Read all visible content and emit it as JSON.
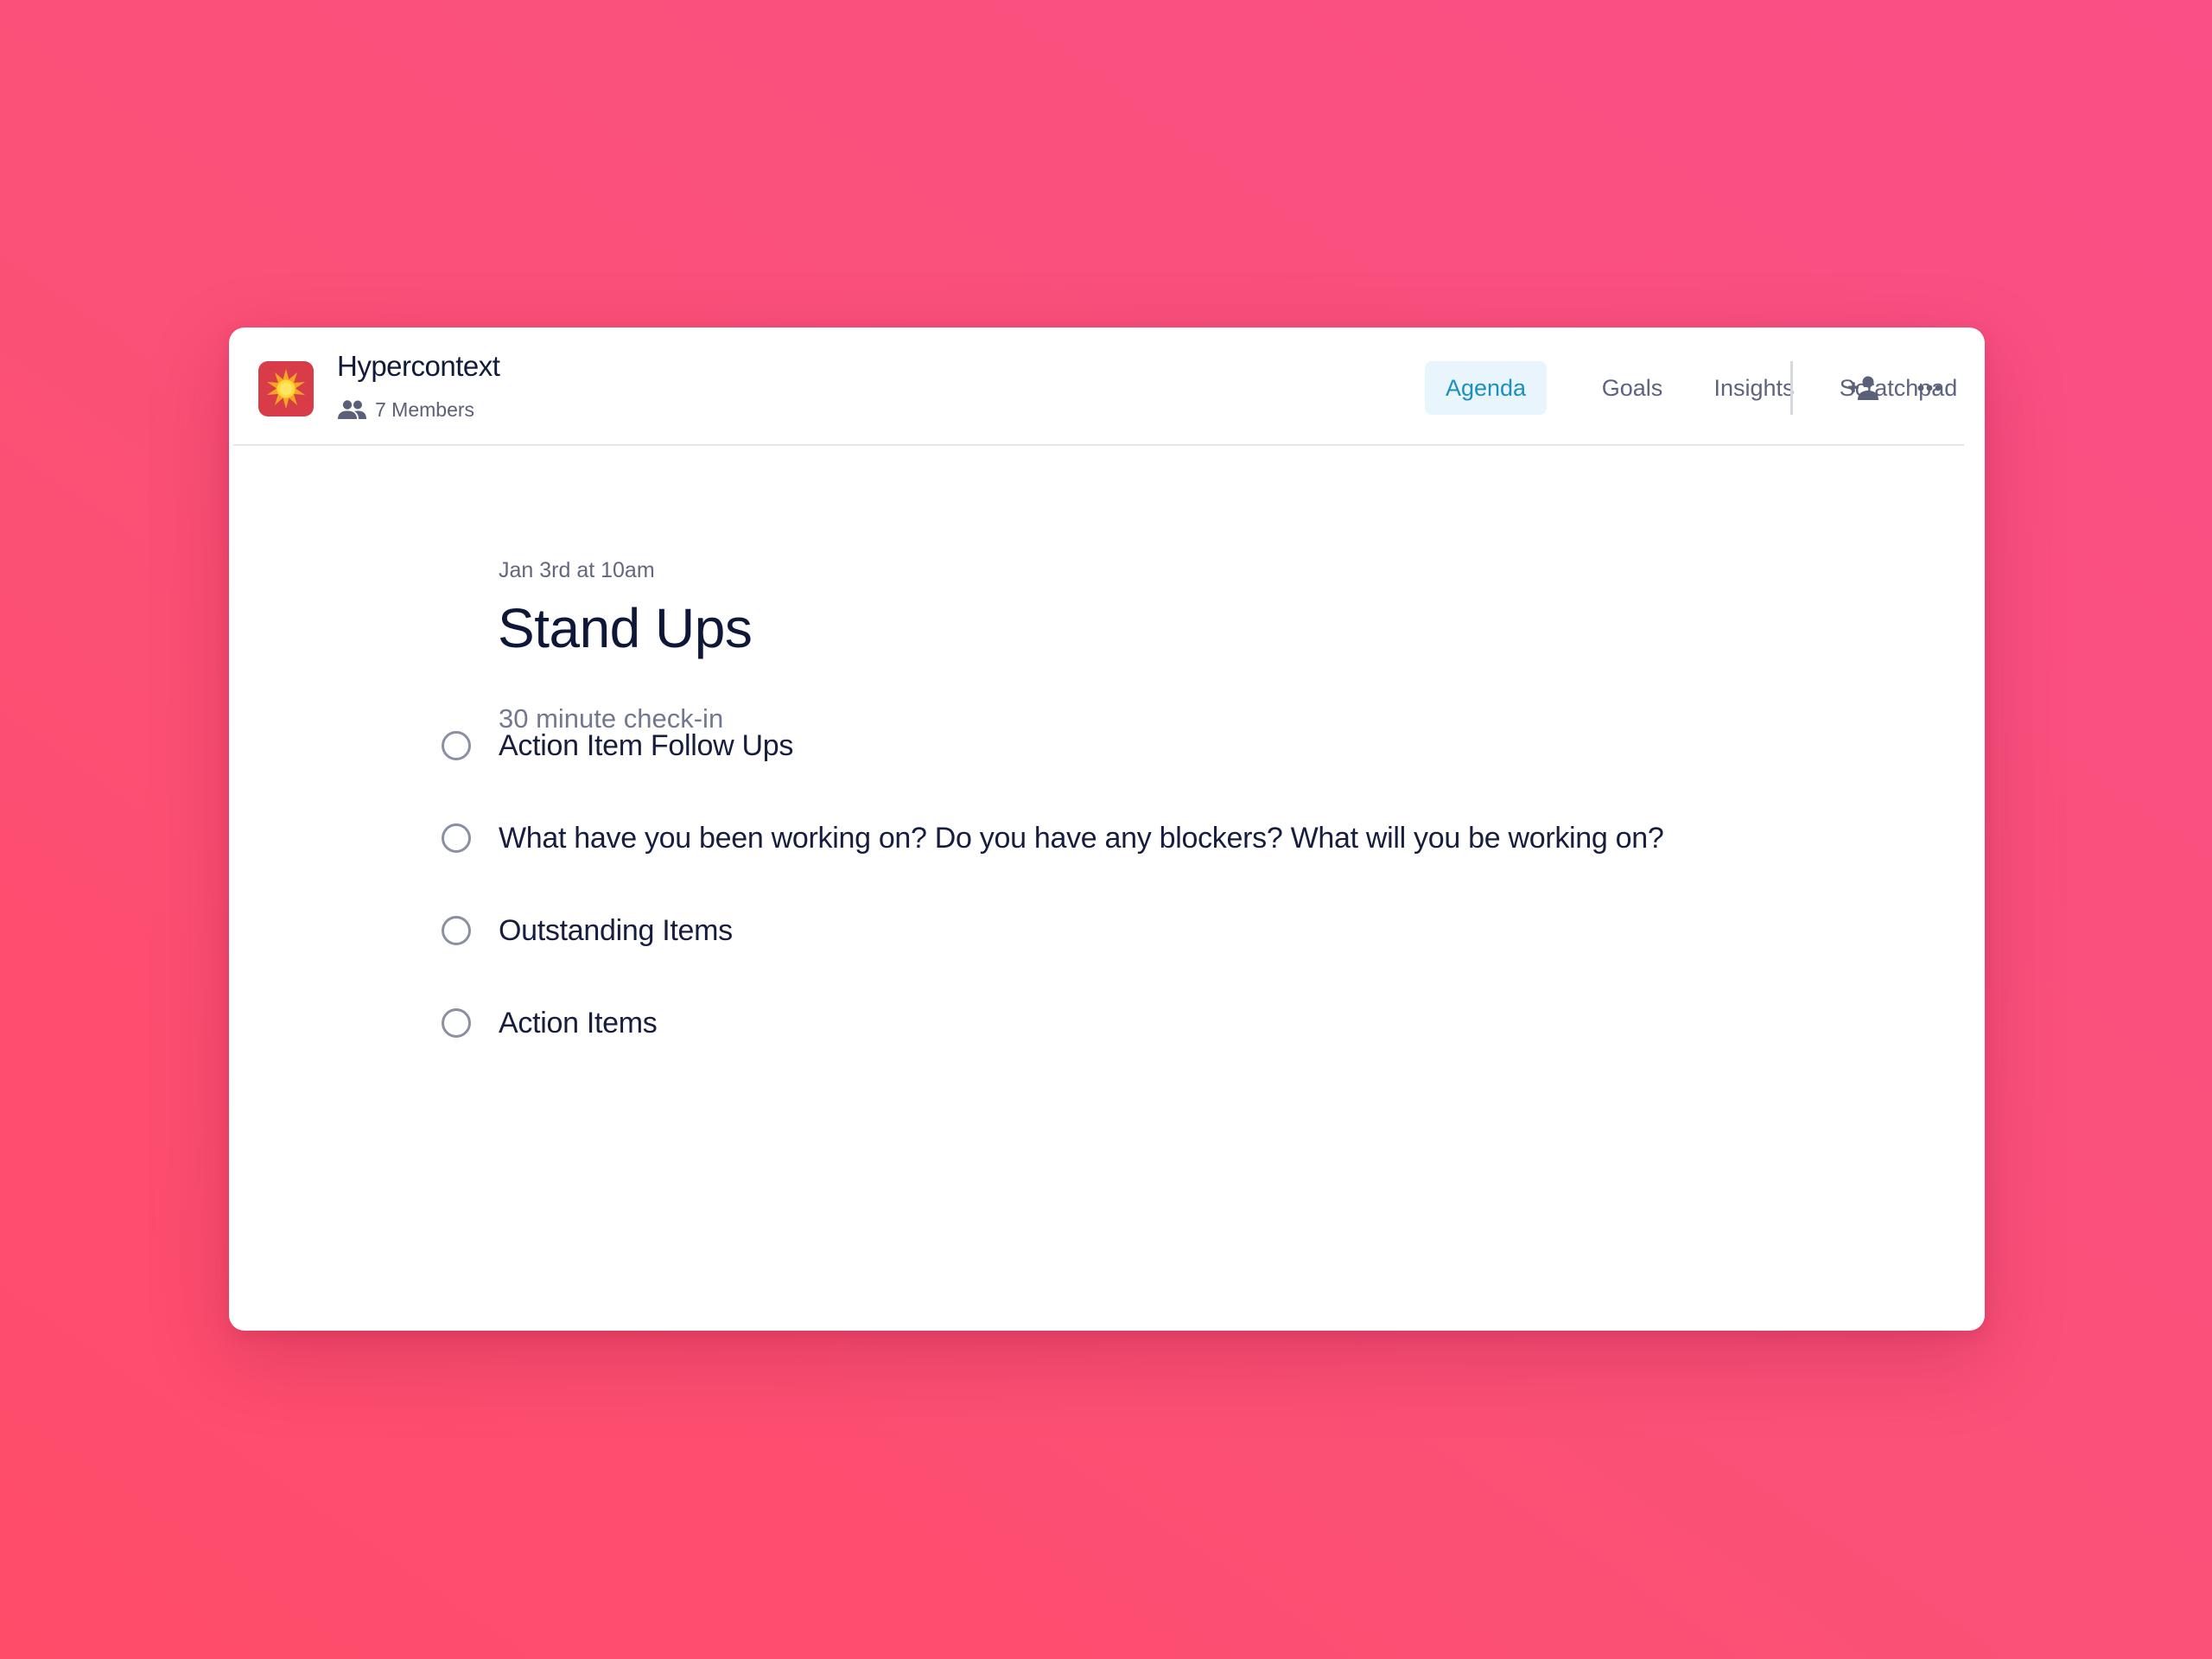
{
  "app": {
    "title": "Hypercontext",
    "members_label": "7 Members",
    "logo_icon": "sun-burst-icon",
    "logo_color": "#d73c48"
  },
  "nav": {
    "tabs": [
      {
        "label": "Agenda",
        "active": true
      },
      {
        "label": "Goals",
        "active": false
      },
      {
        "label": "Insights",
        "active": false
      },
      {
        "label": "Scratchpad",
        "active": false
      }
    ],
    "active_color": "#1a8fc1",
    "add_member_icon": "person-add-icon",
    "more_icon": "more-horizontal-icon"
  },
  "meeting": {
    "date": "Jan 3rd at 10am",
    "title": "Stand Ups",
    "description": "30 minute check-in"
  },
  "agenda": {
    "items": [
      {
        "label": "Action Item Follow Ups",
        "checked": false
      },
      {
        "label": "What have you been working on? Do you have any blockers? What will you be working on?",
        "checked": false
      },
      {
        "label": "Outstanding Items",
        "checked": false
      },
      {
        "label": "Action Items",
        "checked": false
      }
    ]
  },
  "colors": {
    "background_start": "#ff4c69",
    "background_end": "#f94f86",
    "title_text": "#0f1738"
  }
}
